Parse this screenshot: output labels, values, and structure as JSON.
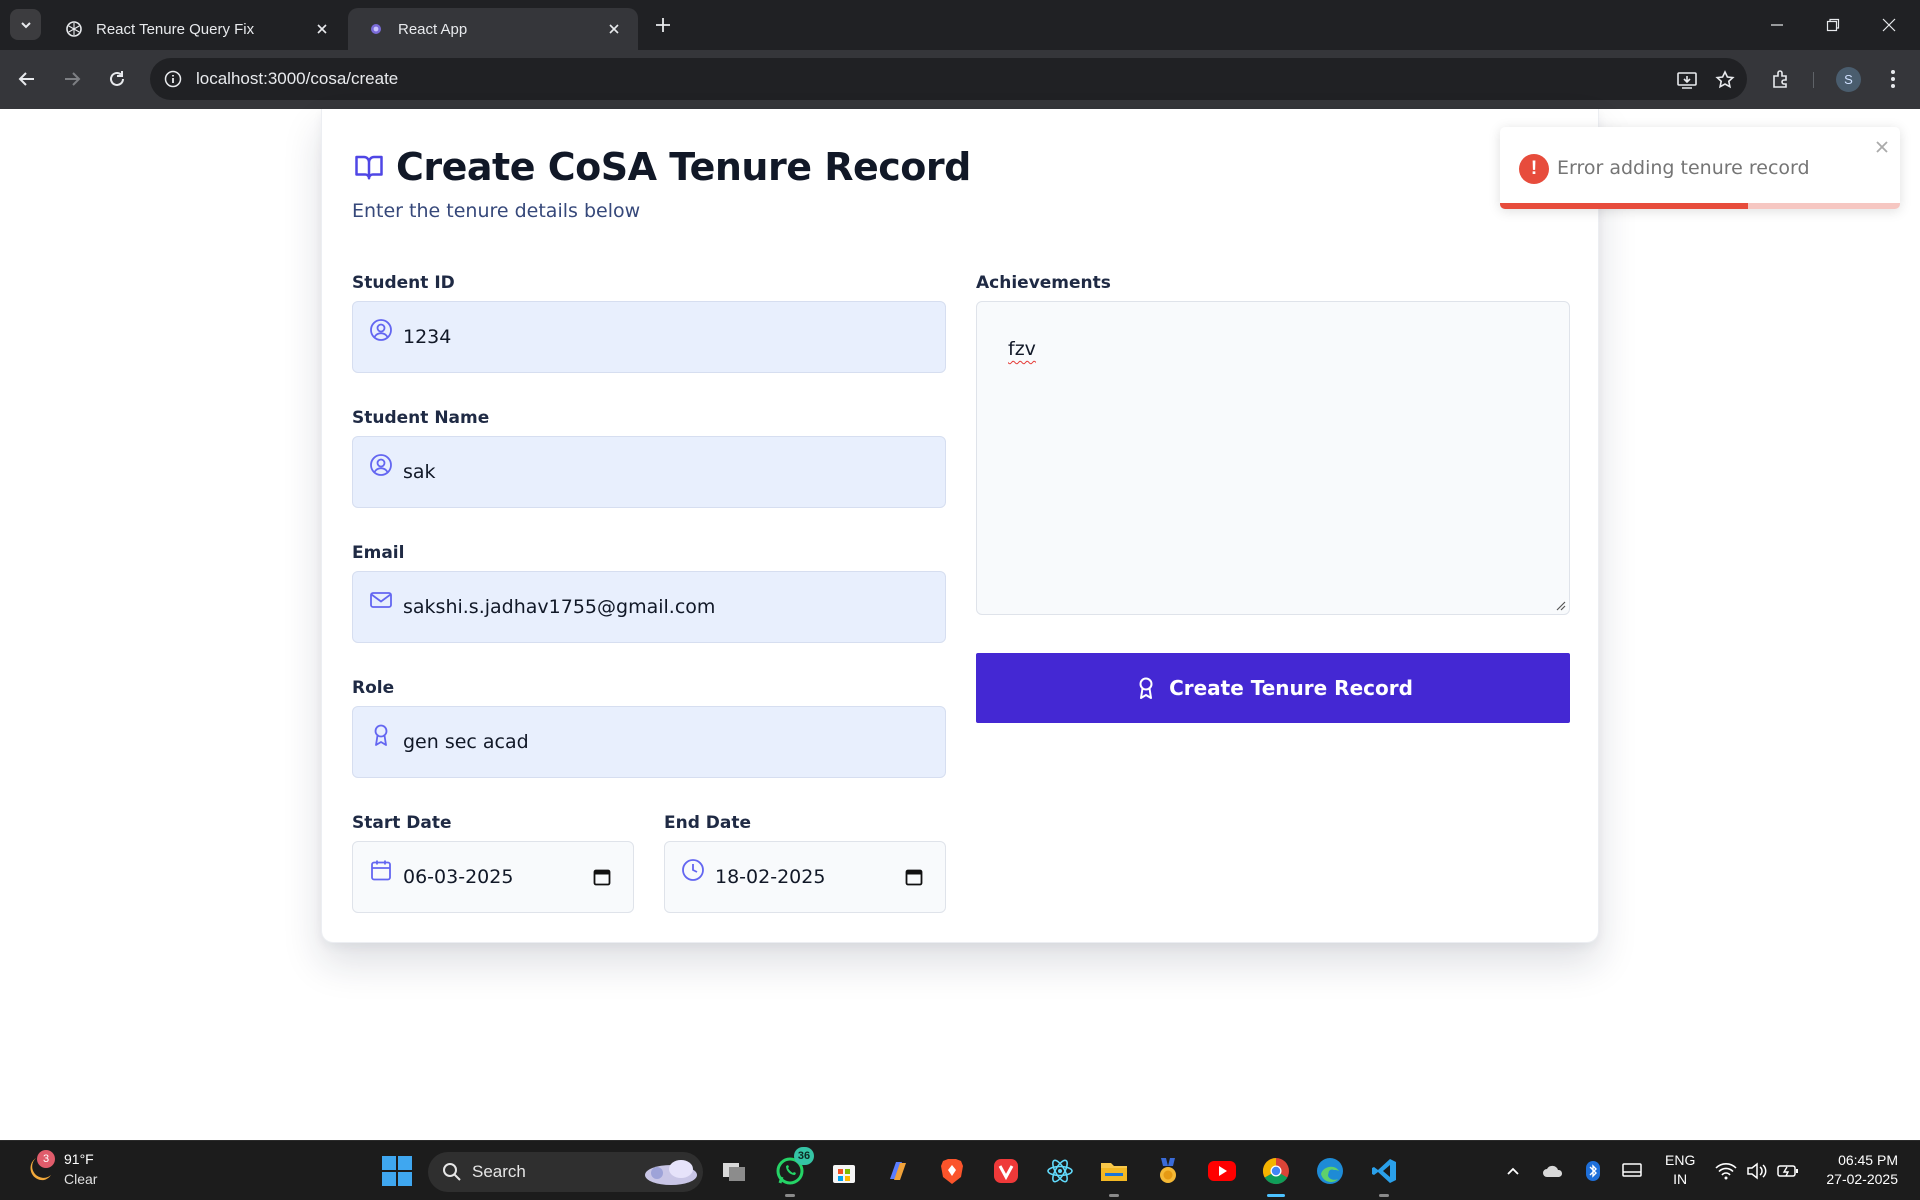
{
  "browser": {
    "tabs": [
      {
        "title": "React Tenure Query Fix",
        "active": false,
        "icon": "openai-icon"
      },
      {
        "title": "React App",
        "active": true,
        "icon": "react-icon"
      }
    ],
    "url": "localhost:3000/cosa/create"
  },
  "page": {
    "title": "Create CoSA Tenure Record",
    "subtitle": "Enter the tenure details below",
    "fields": {
      "student_id": {
        "label": "Student ID",
        "value": "1234",
        "icon": "user-circle-icon"
      },
      "student_name": {
        "label": "Student Name",
        "value": "sak",
        "icon": "user-circle-icon"
      },
      "email": {
        "label": "Email",
        "value": "sakshi.s.jadhav1755@gmail.com",
        "icon": "mail-icon"
      },
      "role": {
        "label": "Role",
        "value": "gen sec acad",
        "icon": "award-icon"
      },
      "start_date": {
        "label": "Start Date",
        "value": "06-03-2025",
        "icon": "calendar-icon"
      },
      "end_date": {
        "label": "End Date",
        "value": "18-02-2025",
        "icon": "clock-icon"
      },
      "achievements": {
        "label": "Achievements",
        "value": "fzv"
      }
    },
    "submit_label": "Create Tenure Record",
    "accent_color": "#4428d3"
  },
  "toast": {
    "message": "Error adding tenure record",
    "type": "error",
    "progress_fraction": 0.62,
    "color": "#e74c3c"
  },
  "taskbar": {
    "weather": {
      "temp": "91°F",
      "condition": "Clear",
      "badge": "3"
    },
    "search_label": "Search",
    "whatsapp_badge": "36",
    "language": [
      "ENG",
      "IN"
    ],
    "time": "06:45 PM",
    "date": "27-02-2025"
  }
}
